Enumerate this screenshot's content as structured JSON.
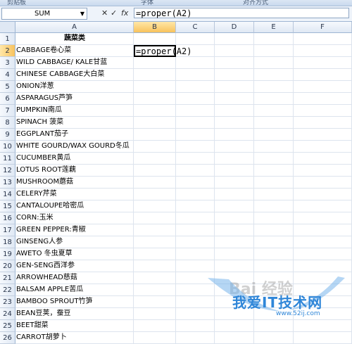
{
  "ribbon": {
    "group_labels": [
      "剪贴板",
      "字体",
      "对齐方式"
    ]
  },
  "formula_bar": {
    "name_box": "SUM",
    "name_box_arrow": "▼",
    "cancel_symbol": "✕",
    "enter_symbol": "✓",
    "fx_symbol": "fx",
    "formula_text": "=proper(A2)"
  },
  "columns": [
    "A",
    "B",
    "C",
    "D",
    "E",
    "F"
  ],
  "active_cell": {
    "column": "B",
    "row": 2
  },
  "rows": [
    {
      "num": "1",
      "a": "蔬菜类",
      "b": ""
    },
    {
      "num": "2",
      "a": "CABBAGE卷心菜",
      "b": "=proper(A2)"
    },
    {
      "num": "3",
      "a": "WILD CABBAGE/ KALE甘蓝",
      "b": ""
    },
    {
      "num": "4",
      "a": "CHINESE CABBAGE大白菜",
      "b": ""
    },
    {
      "num": "5",
      "a": "ONION洋葱",
      "b": ""
    },
    {
      "num": "6",
      "a": "ASPARAGUS芦笋",
      "b": ""
    },
    {
      "num": "7",
      "a": "PUMPKIN南瓜",
      "b": ""
    },
    {
      "num": "8",
      "a": "SPINACH 菠菜",
      "b": ""
    },
    {
      "num": "9",
      "a": "EGGPLANT茄子",
      "b": ""
    },
    {
      "num": "10",
      "a": "WHITE GOURD/WAX GOURD冬瓜",
      "b": ""
    },
    {
      "num": "11",
      "a": "CUCUMBER黄瓜",
      "b": ""
    },
    {
      "num": "12",
      "a": "LOTUS ROOT莲藕",
      "b": ""
    },
    {
      "num": "13",
      "a": "MUSHROOM蘑菇",
      "b": ""
    },
    {
      "num": "14",
      "a": "CELERY芹菜",
      "b": ""
    },
    {
      "num": "15",
      "a": "CANTALOUPE哈密瓜",
      "b": ""
    },
    {
      "num": "16",
      "a": "CORN:玉米",
      "b": ""
    },
    {
      "num": "17",
      "a": "GREEN PEPPER:青椒",
      "b": ""
    },
    {
      "num": "18",
      "a": "GINSENG人参",
      "b": ""
    },
    {
      "num": "19",
      "a": "AWETO 冬虫夏草",
      "b": ""
    },
    {
      "num": "20",
      "a": "GEN-SENG西洋参",
      "b": ""
    },
    {
      "num": "21",
      "a": "ARROWHEAD慈菇",
      "b": ""
    },
    {
      "num": "22",
      "a": "BALSAM APPLE苦瓜",
      "b": ""
    },
    {
      "num": "23",
      "a": "BAMBOO SPROUT竹笋",
      "b": ""
    },
    {
      "num": "24",
      "a": "BEAN豆荚，蚕豆",
      "b": ""
    },
    {
      "num": "25",
      "a": "BEET甜菜",
      "b": ""
    },
    {
      "num": "26",
      "a": "CARROT胡萝卜",
      "b": ""
    }
  ],
  "watermark": {
    "brand": "我爱IT技术网",
    "url": "www.52ij.com",
    "baidu": "Bai 经验"
  }
}
